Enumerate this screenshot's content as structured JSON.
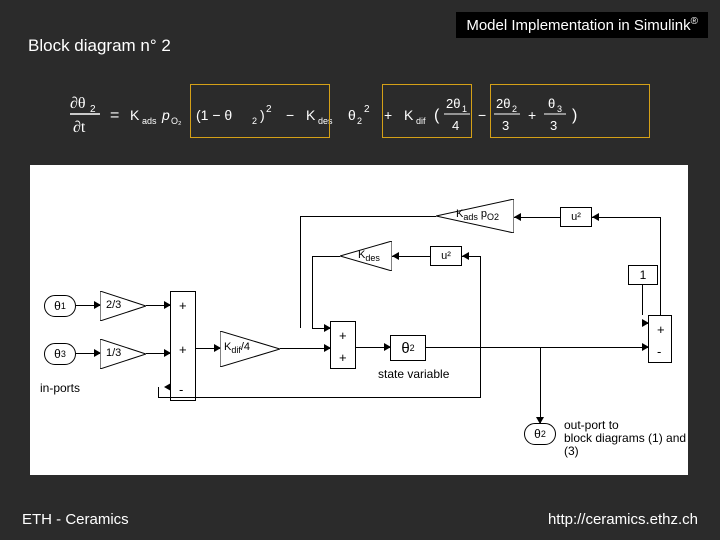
{
  "header": {
    "title_prefix": "Model Implementation in Simulink",
    "reg": "®"
  },
  "title": "Block diagram n° 2",
  "footer": {
    "left": "ETH - Ceramics",
    "right": "http://ceramics.ethz.ch"
  },
  "equation": {
    "lhs": "∂θ₂/∂t",
    "term1": "K_ads p_O₂ (1 − θ₂)²",
    "term2": "− K_des θ₂²",
    "term3": "+ K_dif ( 2θ₁/4 − 2θ₂/3 + θ₃/3 )"
  },
  "ports": {
    "theta1": "θ",
    "theta1_sub": "1",
    "theta3": "θ",
    "theta3_sub": "3",
    "theta2_state": "θ",
    "theta2_state_sub": "2",
    "theta2_out": "θ",
    "theta2_out_sub": "2"
  },
  "gains": {
    "g1": "2/3",
    "g2": "1/3",
    "kdif": "K",
    "kdif_sub": "dif",
    "kdif_suffix": "/4",
    "kads_prefix": "K",
    "kads_sub": "ads",
    "kads_suffix": " p",
    "kads_o2": "O2",
    "kdes": "K",
    "kdes_sub": "des"
  },
  "blocks": {
    "usq": "u²",
    "const1": "1"
  },
  "sum1": {
    "a": "+",
    "b": "+",
    "c": "-"
  },
  "sum2": {
    "a": "+",
    "b": "+"
  },
  "sum3": {
    "a": "+",
    "b": "-"
  },
  "labels": {
    "in_ports": "in-ports",
    "state_var": "state variable",
    "outport": "out-port to\nblock diagrams (1) and (3)"
  }
}
